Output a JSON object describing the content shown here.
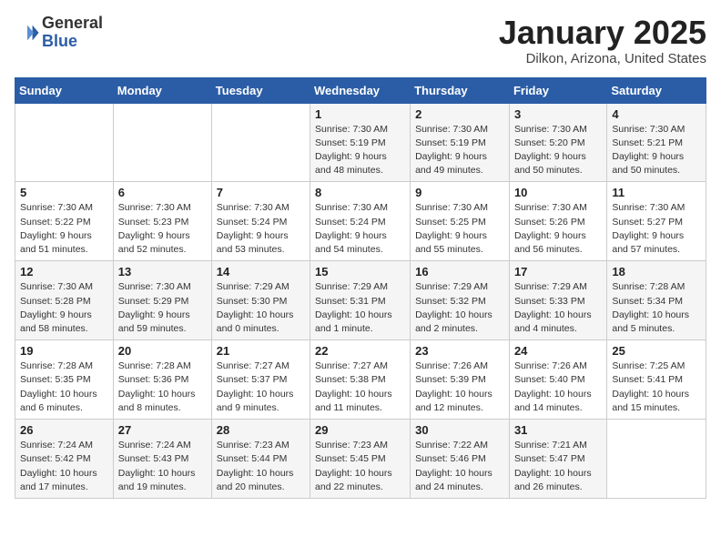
{
  "header": {
    "logo_general": "General",
    "logo_blue": "Blue",
    "title": "January 2025",
    "subtitle": "Dilkon, Arizona, United States"
  },
  "days_of_week": [
    "Sunday",
    "Monday",
    "Tuesday",
    "Wednesday",
    "Thursday",
    "Friday",
    "Saturday"
  ],
  "weeks": [
    [
      {
        "day": "",
        "detail": ""
      },
      {
        "day": "",
        "detail": ""
      },
      {
        "day": "",
        "detail": ""
      },
      {
        "day": "1",
        "detail": "Sunrise: 7:30 AM\nSunset: 5:19 PM\nDaylight: 9 hours\nand 48 minutes."
      },
      {
        "day": "2",
        "detail": "Sunrise: 7:30 AM\nSunset: 5:19 PM\nDaylight: 9 hours\nand 49 minutes."
      },
      {
        "day": "3",
        "detail": "Sunrise: 7:30 AM\nSunset: 5:20 PM\nDaylight: 9 hours\nand 50 minutes."
      },
      {
        "day": "4",
        "detail": "Sunrise: 7:30 AM\nSunset: 5:21 PM\nDaylight: 9 hours\nand 50 minutes."
      }
    ],
    [
      {
        "day": "5",
        "detail": "Sunrise: 7:30 AM\nSunset: 5:22 PM\nDaylight: 9 hours\nand 51 minutes."
      },
      {
        "day": "6",
        "detail": "Sunrise: 7:30 AM\nSunset: 5:23 PM\nDaylight: 9 hours\nand 52 minutes."
      },
      {
        "day": "7",
        "detail": "Sunrise: 7:30 AM\nSunset: 5:24 PM\nDaylight: 9 hours\nand 53 minutes."
      },
      {
        "day": "8",
        "detail": "Sunrise: 7:30 AM\nSunset: 5:24 PM\nDaylight: 9 hours\nand 54 minutes."
      },
      {
        "day": "9",
        "detail": "Sunrise: 7:30 AM\nSunset: 5:25 PM\nDaylight: 9 hours\nand 55 minutes."
      },
      {
        "day": "10",
        "detail": "Sunrise: 7:30 AM\nSunset: 5:26 PM\nDaylight: 9 hours\nand 56 minutes."
      },
      {
        "day": "11",
        "detail": "Sunrise: 7:30 AM\nSunset: 5:27 PM\nDaylight: 9 hours\nand 57 minutes."
      }
    ],
    [
      {
        "day": "12",
        "detail": "Sunrise: 7:30 AM\nSunset: 5:28 PM\nDaylight: 9 hours\nand 58 minutes."
      },
      {
        "day": "13",
        "detail": "Sunrise: 7:30 AM\nSunset: 5:29 PM\nDaylight: 9 hours\nand 59 minutes."
      },
      {
        "day": "14",
        "detail": "Sunrise: 7:29 AM\nSunset: 5:30 PM\nDaylight: 10 hours\nand 0 minutes."
      },
      {
        "day": "15",
        "detail": "Sunrise: 7:29 AM\nSunset: 5:31 PM\nDaylight: 10 hours\nand 1 minute."
      },
      {
        "day": "16",
        "detail": "Sunrise: 7:29 AM\nSunset: 5:32 PM\nDaylight: 10 hours\nand 2 minutes."
      },
      {
        "day": "17",
        "detail": "Sunrise: 7:29 AM\nSunset: 5:33 PM\nDaylight: 10 hours\nand 4 minutes."
      },
      {
        "day": "18",
        "detail": "Sunrise: 7:28 AM\nSunset: 5:34 PM\nDaylight: 10 hours\nand 5 minutes."
      }
    ],
    [
      {
        "day": "19",
        "detail": "Sunrise: 7:28 AM\nSunset: 5:35 PM\nDaylight: 10 hours\nand 6 minutes."
      },
      {
        "day": "20",
        "detail": "Sunrise: 7:28 AM\nSunset: 5:36 PM\nDaylight: 10 hours\nand 8 minutes."
      },
      {
        "day": "21",
        "detail": "Sunrise: 7:27 AM\nSunset: 5:37 PM\nDaylight: 10 hours\nand 9 minutes."
      },
      {
        "day": "22",
        "detail": "Sunrise: 7:27 AM\nSunset: 5:38 PM\nDaylight: 10 hours\nand 11 minutes."
      },
      {
        "day": "23",
        "detail": "Sunrise: 7:26 AM\nSunset: 5:39 PM\nDaylight: 10 hours\nand 12 minutes."
      },
      {
        "day": "24",
        "detail": "Sunrise: 7:26 AM\nSunset: 5:40 PM\nDaylight: 10 hours\nand 14 minutes."
      },
      {
        "day": "25",
        "detail": "Sunrise: 7:25 AM\nSunset: 5:41 PM\nDaylight: 10 hours\nand 15 minutes."
      }
    ],
    [
      {
        "day": "26",
        "detail": "Sunrise: 7:24 AM\nSunset: 5:42 PM\nDaylight: 10 hours\nand 17 minutes."
      },
      {
        "day": "27",
        "detail": "Sunrise: 7:24 AM\nSunset: 5:43 PM\nDaylight: 10 hours\nand 19 minutes."
      },
      {
        "day": "28",
        "detail": "Sunrise: 7:23 AM\nSunset: 5:44 PM\nDaylight: 10 hours\nand 20 minutes."
      },
      {
        "day": "29",
        "detail": "Sunrise: 7:23 AM\nSunset: 5:45 PM\nDaylight: 10 hours\nand 22 minutes."
      },
      {
        "day": "30",
        "detail": "Sunrise: 7:22 AM\nSunset: 5:46 PM\nDaylight: 10 hours\nand 24 minutes."
      },
      {
        "day": "31",
        "detail": "Sunrise: 7:21 AM\nSunset: 5:47 PM\nDaylight: 10 hours\nand 26 minutes."
      },
      {
        "day": "",
        "detail": ""
      }
    ]
  ]
}
